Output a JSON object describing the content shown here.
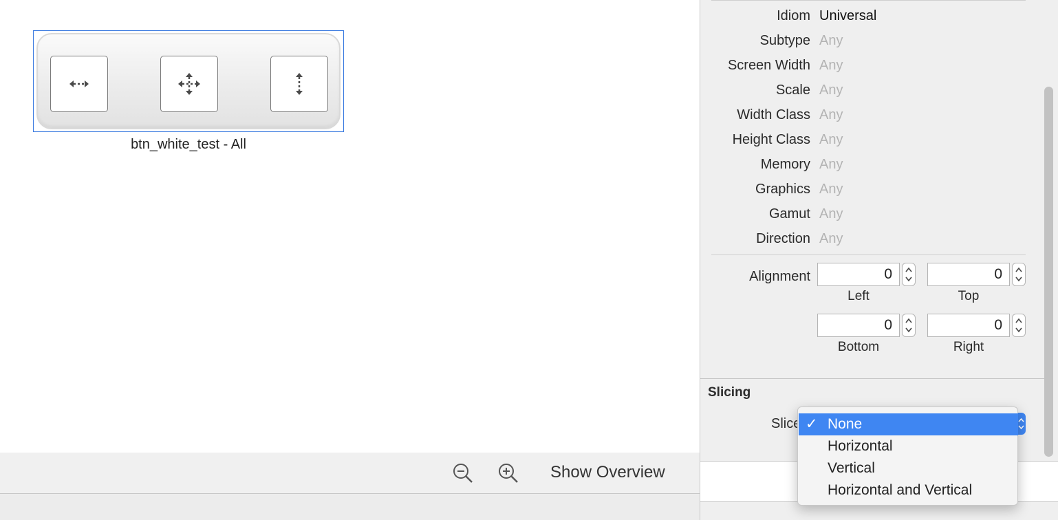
{
  "canvas": {
    "asset_label": "btn_white_test - All",
    "slice_buttons": [
      {
        "icon": "horizontal-resize-icon"
      },
      {
        "icon": "move-icon"
      },
      {
        "icon": "vertical-resize-icon"
      }
    ]
  },
  "toolbar": {
    "zoom_out_icon": "zoom-out-icon",
    "zoom_in_icon": "zoom-in-icon",
    "show_overview_label": "Show Overview"
  },
  "inspector": {
    "properties": [
      {
        "label": "Idiom",
        "value": "Universal"
      },
      {
        "label": "Subtype",
        "value": "Any"
      },
      {
        "label": "Screen Width",
        "value": "Any"
      },
      {
        "label": "Scale",
        "value": "Any"
      },
      {
        "label": "Width Class",
        "value": "Any"
      },
      {
        "label": "Height Class",
        "value": "Any"
      },
      {
        "label": "Memory",
        "value": "Any"
      },
      {
        "label": "Graphics",
        "value": "Any"
      },
      {
        "label": "Gamut",
        "value": "Any"
      },
      {
        "label": "Direction",
        "value": "Any"
      }
    ],
    "alignment": {
      "label": "Alignment",
      "left": {
        "caption": "Left",
        "value": "0"
      },
      "top": {
        "caption": "Top",
        "value": "0"
      },
      "bottom": {
        "caption": "Bottom",
        "value": "0"
      },
      "right": {
        "caption": "Right",
        "value": "0"
      }
    },
    "slicing": {
      "title": "Slicing",
      "slices_label": "Slice",
      "options": [
        "None",
        "Horizontal",
        "Vertical",
        "Horizontal and Vertical"
      ],
      "selected": "None",
      "checkmark": "✓"
    }
  },
  "colors": {
    "accent": "#3f86f2",
    "selection_border": "#3b7be0",
    "placeholder_text": "#b3b3b3"
  }
}
